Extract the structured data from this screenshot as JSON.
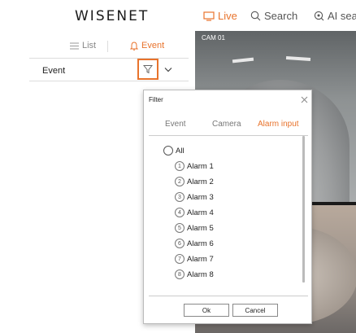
{
  "header": {
    "logo": "WISENET",
    "nav": [
      {
        "label": "Live",
        "icon": "monitor-icon",
        "active": true
      },
      {
        "label": "Search",
        "icon": "search-icon",
        "active": false
      },
      {
        "label": "AI sear",
        "icon": "ai-search-icon",
        "active": false
      }
    ]
  },
  "left_panel": {
    "tabs": [
      {
        "label": "List",
        "icon": "list-icon",
        "active": false
      },
      {
        "label": "Event",
        "icon": "event-icon",
        "active": true
      }
    ],
    "event_row": {
      "label": "Event"
    }
  },
  "video": {
    "camera_label": "CAM 01"
  },
  "filter_dialog": {
    "title": "Filter",
    "tabs": [
      {
        "label": "Event",
        "active": false
      },
      {
        "label": "Camera",
        "active": false
      },
      {
        "label": "Alarm input",
        "active": true
      }
    ],
    "all_label": "All",
    "alarms": [
      {
        "num": "1",
        "label": "Alarm 1"
      },
      {
        "num": "2",
        "label": "Alarm 2"
      },
      {
        "num": "3",
        "label": "Alarm 3"
      },
      {
        "num": "4",
        "label": "Alarm 4"
      },
      {
        "num": "5",
        "label": "Alarm 5"
      },
      {
        "num": "6",
        "label": "Alarm 6"
      },
      {
        "num": "7",
        "label": "Alarm 7"
      },
      {
        "num": "8",
        "label": "Alarm 8"
      }
    ],
    "ok_label": "Ok",
    "cancel_label": "Cancel"
  },
  "colors": {
    "accent": "#e8732c"
  }
}
